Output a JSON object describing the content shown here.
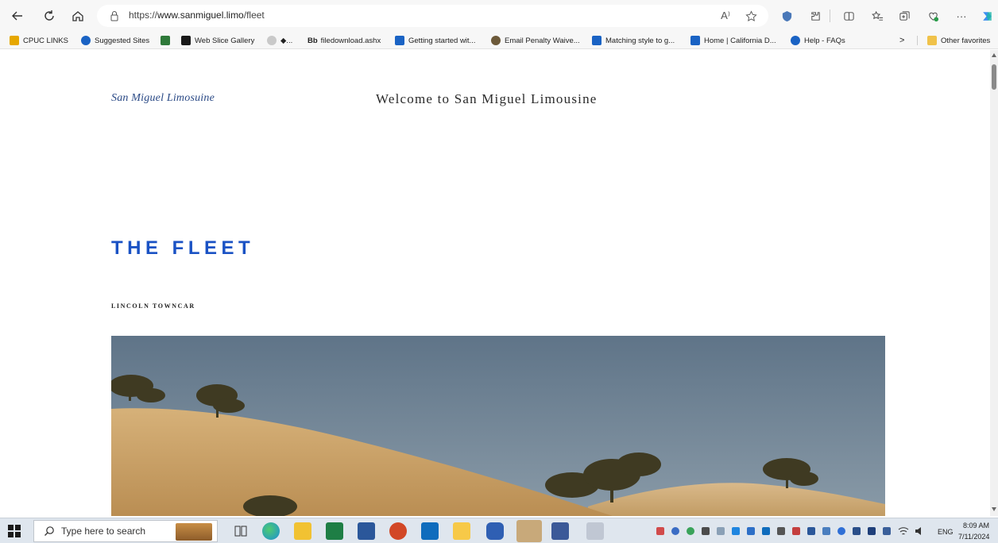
{
  "browser": {
    "url_prefix": "https://",
    "url_host": "www.sanmiguel.limo",
    "url_path": "/fleet",
    "read_aloud_label": "A⁾",
    "more_label": "···"
  },
  "bookmarks": [
    {
      "label": "CPUC LINKS",
      "color": "#e6a700"
    },
    {
      "label": "Suggested Sites",
      "color": "#1a63c4"
    },
    {
      "label": "",
      "color": "#2f7a3a"
    },
    {
      "label": "Web Slice Gallery",
      "color": "#1a1a1a"
    },
    {
      "label": "◆...",
      "color": "#c9c9c9"
    },
    {
      "label": "filedownload.ashx",
      "color": "#222222",
      "prefix": "Bb"
    },
    {
      "label": "Getting started wit...",
      "color": "#1a63c4"
    },
    {
      "label": "Email Penalty Waive...",
      "color": "#6d5a3a"
    },
    {
      "label": "Matching style to g...",
      "color": "#1a63c4"
    },
    {
      "label": "Home | California D...",
      "color": "#1a63c4"
    },
    {
      "label": "Help - FAQs",
      "color": "#1a63c4"
    }
  ],
  "bookmarks_overflow": ">",
  "other_favorites": "Other favorites",
  "site": {
    "logo": "San Miguel Limosuine",
    "welcome": "Welcome to San Miguel Limousine",
    "heading": "THE FLEET",
    "car_title": "LINCOLN TOWNCAR"
  },
  "taskbar": {
    "search_placeholder": "Type here to search",
    "language": "ENG",
    "time": "8:09 AM",
    "date": "7/11/2024"
  },
  "colors": {
    "heading_blue": "#1a52c4",
    "logo_blue": "#2b4a86"
  }
}
